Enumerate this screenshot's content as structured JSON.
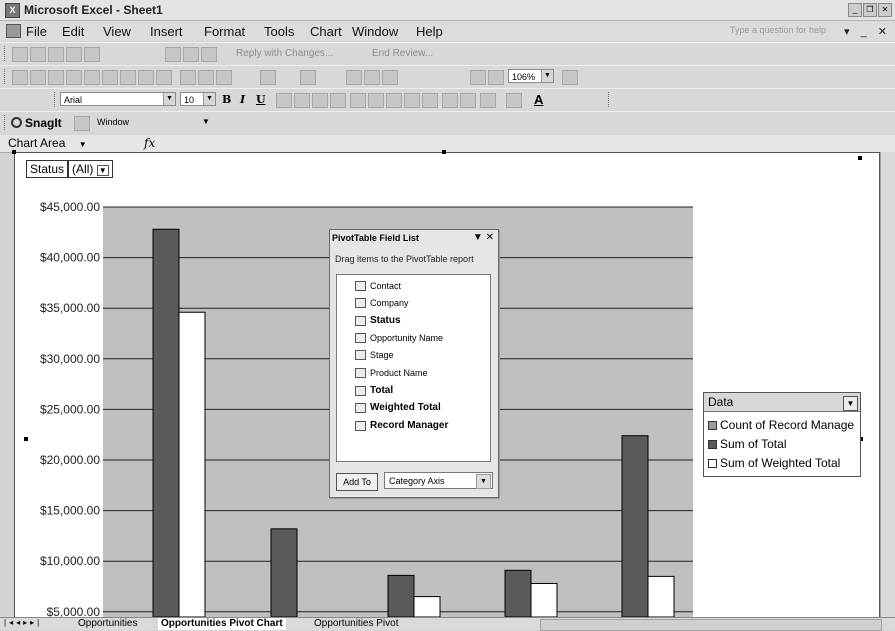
{
  "window": {
    "title": "Microsoft Excel - Sheet1"
  },
  "menu": {
    "items": [
      "File",
      "Edit",
      "View",
      "Insert",
      "Format",
      "Tools",
      "Chart",
      "Window",
      "Help"
    ],
    "help_placeholder": "Type a question for help"
  },
  "review_toolbar": {
    "reply_label": "Reply with Changes...",
    "end_review_label": "End Review..."
  },
  "standard_toolbar": {
    "zoom": "106%"
  },
  "format_toolbar": {
    "font": "Arial",
    "size": "10",
    "bold": "B",
    "italic": "I",
    "underline": "U"
  },
  "snagit_toolbar": {
    "label": "SnagIt",
    "capture_mode": "Window"
  },
  "name_box": {
    "value": "Chart Area",
    "fx": "fx"
  },
  "page_field": {
    "label": "Status",
    "value": "(All)"
  },
  "pivot_field_list": {
    "title": "PivotTable Field List",
    "description": "Drag items to the PivotTable report",
    "fields": [
      {
        "name": "Contact",
        "bold": false
      },
      {
        "name": "Company",
        "bold": false
      },
      {
        "name": "Status",
        "bold": true
      },
      {
        "name": "Opportunity Name",
        "bold": false
      },
      {
        "name": "Stage",
        "bold": false
      },
      {
        "name": "Product Name",
        "bold": false
      },
      {
        "name": "Total",
        "bold": true
      },
      {
        "name": "Weighted Total",
        "bold": true
      },
      {
        "name": "Record Manager",
        "bold": true
      }
    ],
    "add_button": "Add To",
    "area_select": "Category Axis"
  },
  "legend": {
    "title": "Data",
    "items": [
      {
        "label": "Count of Record Manage",
        "color": "#9a9a9a"
      },
      {
        "label": "Sum of Total",
        "color": "#5a5a5a"
      },
      {
        "label": "Sum of Weighted Total",
        "color": "#ffffff"
      }
    ]
  },
  "chart_data": {
    "type": "bar",
    "y_ticks": [
      "$45,000.00",
      "$40,000.00",
      "$35,000.00",
      "$30,000.00",
      "$25,000.00",
      "$20,000.00",
      "$15,000.00",
      "$10,000.00",
      "$5,000.00"
    ],
    "ylim": [
      4500,
      45000
    ],
    "series": [
      {
        "name": "Sum of Total",
        "values": [
          42800,
          13200,
          8600,
          9100,
          22400
        ]
      },
      {
        "name": "Sum of Weighted Total",
        "values": [
          34600,
          null,
          6500,
          7800,
          8500
        ]
      }
    ],
    "colors": {
      "plot_bg": "#c0c0c0",
      "total": "#5a5a5a",
      "weighted": "#ffffff"
    }
  },
  "sheet_tabs": [
    "Opportunities",
    "Opportunities Pivot Chart",
    "Opportunities Pivot"
  ],
  "active_tab": "Opportunities Pivot Chart"
}
